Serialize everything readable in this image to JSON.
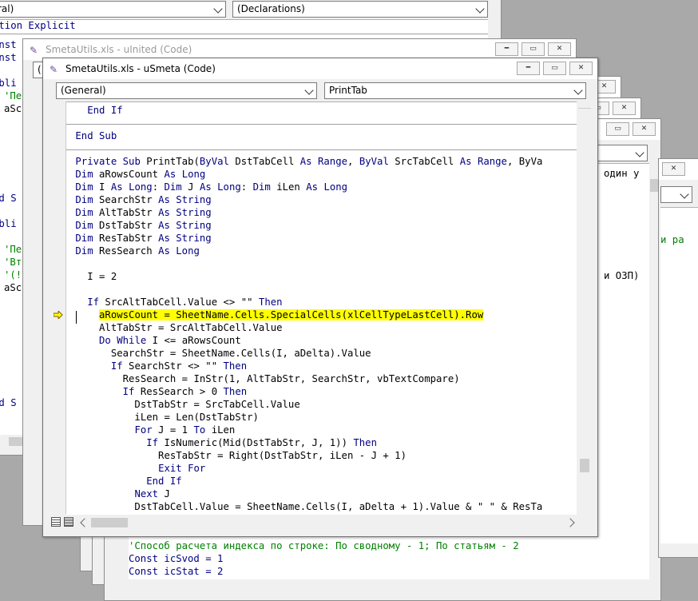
{
  "windows": {
    "back": {
      "combo_left": "ral)",
      "combo_right": "(Declarations)",
      "lines": [
        "ption Explicit",
        "onst",
        "onst",
        "ubli",
        "'Пе",
        "aSc",
        "nd S",
        "ubli",
        "'Пе",
        "'Вт",
        "'(!",
        "aSc",
        "nd S"
      ]
    },
    "united": {
      "title": "SmetaUtils.xls - uInited (Code)",
      "combo_left": "("
    },
    "main": {
      "title": "SmetaUtils.xls - uSmeta (Code)",
      "combo_left": "(General)",
      "combo_right": "PrintTab"
    },
    "right": {
      "lines": [
        "один у",
        "и ра",
        "и ОЗП)"
      ]
    },
    "bottom": {
      "lines": [
        "'Способ расчета индекса по строке: По сводному - 1; По статьям - 2",
        "Const icSvod = 1",
        "Const icStat = 2"
      ]
    }
  },
  "code_lines": [
    "   End If",
    "",
    " End Sub",
    "",
    " Private Sub PrintTab(ByVal DstTabCell As Range, ByVal SrcTabCell As Range, ByVa",
    " Dim aRowsCount As Long",
    " Dim I As Long: Dim J As Long: Dim iLen As Long",
    " Dim SearchStr As String",
    " Dim AltTabStr As String",
    " Dim DstTabStr As String",
    " Dim ResTabStr As String",
    " Dim ResSearch As Long",
    "",
    "   I = 2",
    "",
    "   If SrcAltTabCell.Value <> \"\" Then",
    "     aRowsCount = SheetName.Cells.SpecialCells(xlCellTypeLastCell).Row",
    "     AltTabStr = SrcAltTabCell.Value",
    "     Do While I <= aRowsCount",
    "       SearchStr = SheetName.Cells(I, aDelta).Value",
    "       If SearchStr <> \"\" Then",
    "         ResSearch = InStr(1, AltTabStr, SearchStr, vbTextCompare)",
    "         If ResSearch > 0 Then",
    "           DstTabStr = SrcTabCell.Value",
    "           iLen = Len(DstTabStr)",
    "           For J = 1 To iLen",
    "             If IsNumeric(Mid(DstTabStr, J, 1)) Then",
    "               ResTabStr = Right(DstTabStr, iLen - J + 1)",
    "               Exit For",
    "             End If",
    "           Next J",
    "           DstTabCell.Value = SheetName.Cells(I, aDelta + 1).Value & \" \" & ResTa"
  ],
  "highlighted_line_index": 16,
  "colors": {
    "keyword": "#000080",
    "comment": "#008000",
    "highlight": "#ffff00",
    "mdi_background": "#a9a9a9"
  }
}
